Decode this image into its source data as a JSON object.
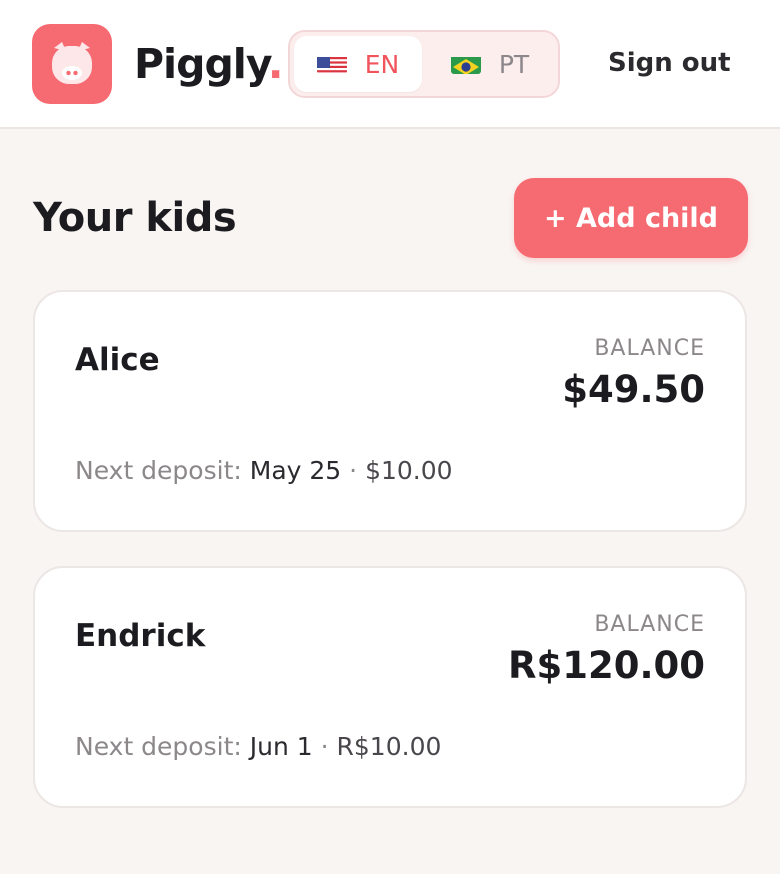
{
  "header": {
    "brand_name": "Piggly",
    "brand_dot": ".",
    "languages": [
      {
        "flag": "us-flag-icon",
        "code": "EN",
        "active": true
      },
      {
        "flag": "brazil-flag-icon",
        "code": "PT",
        "active": false
      }
    ],
    "sign_out_label": "Sign out"
  },
  "main": {
    "title": "Your kids",
    "add_child_label": "+ Add child",
    "kids": [
      {
        "name": "Alice",
        "balance_label": "BALANCE",
        "balance": "$49.50",
        "next_deposit_label": "Next deposit:",
        "next_deposit_date": "May 25",
        "separator": "·",
        "next_deposit_amount": "$10.00"
      },
      {
        "name": "Endrick",
        "balance_label": "BALANCE",
        "balance": "R$120.00",
        "next_deposit_label": "Next deposit:",
        "next_deposit_date": "Jun 1",
        "separator": "·",
        "next_deposit_amount": "R$10.00"
      }
    ]
  },
  "colors": {
    "accent": "#f66a72",
    "background": "#f9f5f3",
    "text": "#1c1b1f",
    "muted": "#8b878a"
  }
}
